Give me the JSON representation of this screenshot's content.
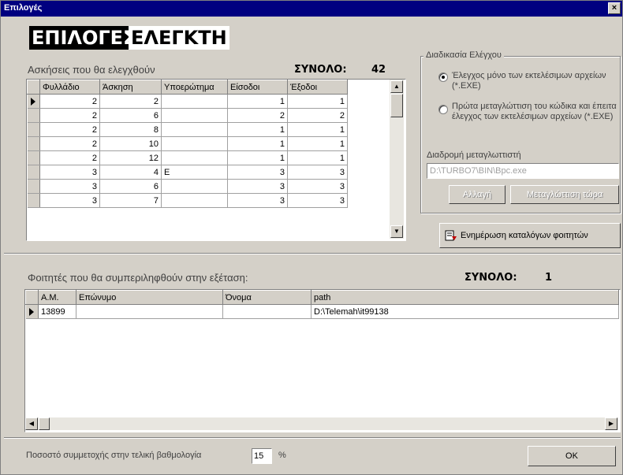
{
  "window": {
    "title": "Επιλογές",
    "close_glyph": "×"
  },
  "banner": {
    "part1": "ΕΠΙΛΟΓΕΣ",
    "part2": "ΕΛΕΓΚΤΗ"
  },
  "exercises": {
    "heading": "Ασκήσεις που θα ελεγχθούν",
    "total_label": "ΣΥΝΟΛΟ:",
    "total_value": "42",
    "columns": [
      "Φυλλάδιο",
      "Άσκηση",
      "Υποερώτημα",
      "Είσοδοι",
      "Έξοδοι"
    ],
    "rows": [
      [
        "2",
        "2",
        "",
        "1",
        "1"
      ],
      [
        "2",
        "6",
        "",
        "2",
        "2"
      ],
      [
        "2",
        "8",
        "",
        "1",
        "1"
      ],
      [
        "2",
        "10",
        "",
        "1",
        "1"
      ],
      [
        "2",
        "12",
        "",
        "1",
        "1"
      ],
      [
        "3",
        "4",
        "Ε",
        "3",
        "3"
      ],
      [
        "3",
        "6",
        "",
        "3",
        "3"
      ],
      [
        "3",
        "7",
        "",
        "3",
        "3"
      ]
    ]
  },
  "process": {
    "title": "Διαδικασία Ελέγχου",
    "option1": "Έλεγχος μόνο των εκτελέσιμων αρχείων (*.EXE)",
    "option2": "Πρώτα μεταγλώττιση του κώδικα και έπειτα έλεγχος των εκτελέσιμων αρχείων (*.EXE)",
    "compiler_path_label": "Διαδρομή μεταγλωττιστή",
    "compiler_path_value": "D:\\TURBO7\\BIN\\Bpc.exe",
    "change_button": "Αλλαγή",
    "compile_button": "Μεταγλώττιση τώρα"
  },
  "update_button": "Ενημέρωση καταλόγων φοιτητών",
  "students": {
    "heading": "Φοιτητές που θα συμπεριληφθούν στην εξέταση:",
    "total_label": "ΣΥΝΟΛΟ:",
    "total_value": "1",
    "columns": [
      "Α.Μ.",
      "Επώνυμο",
      "Όνομα",
      "path"
    ],
    "rows": [
      [
        "13899",
        "",
        "",
        "D:\\Telemah\\it99138"
      ]
    ]
  },
  "footer": {
    "percent_label": "Ποσοστό συμμετοχής στην τελική βαθμολογία",
    "percent_value": "15",
    "percent_unit": "%",
    "ok_button": "OK"
  },
  "colors": {
    "titlebar": "#000080",
    "face": "#d4d0c8"
  }
}
